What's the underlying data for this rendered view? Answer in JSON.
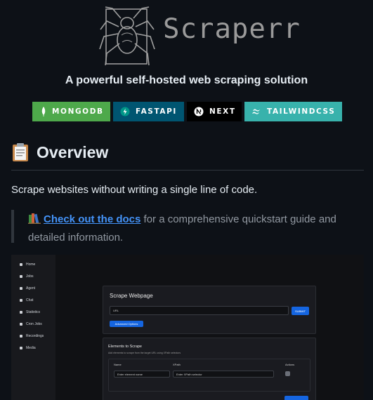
{
  "header": {
    "logo_text": "Scraperr",
    "tagline": "A powerful self-hosted web scraping solution"
  },
  "badges": [
    {
      "label": "MONGODB",
      "color": "#4ea94b"
    },
    {
      "label": "FASTAPI",
      "color": "#005571"
    },
    {
      "label": "NEXT",
      "color": "#000000"
    },
    {
      "label": "TAILWINDCSS",
      "color": "#38b2ac"
    }
  ],
  "overview": {
    "heading": "Overview",
    "intro": "Scrape websites without writing a single line of code.",
    "docs_link": "Check out the docs",
    "docs_rest": " for a comprehensive quickstart guide and detailed information."
  },
  "screenshot": {
    "sidebar": [
      "Home",
      "Jobs",
      "Agent",
      "Chat",
      "Statistics",
      "Cron Jobs",
      "Recordings",
      "Media"
    ],
    "scrape_title": "Scrape Webpage",
    "url_label": "URL",
    "submit_label": "SUBMIT",
    "advanced_label": "Advanced Options",
    "elements_title": "Elements to Scrape",
    "elements_sub": "Add elements to scrape from the target URL using XPath selectors",
    "col_name": "Name",
    "col_xpath": "XPath",
    "col_actions": "Actions",
    "name_placeholder": "Enter element name",
    "xpath_placeholder": "Enter XPath selector"
  },
  "colors": {
    "accent": "#4493f8",
    "background": "#0d1117"
  }
}
